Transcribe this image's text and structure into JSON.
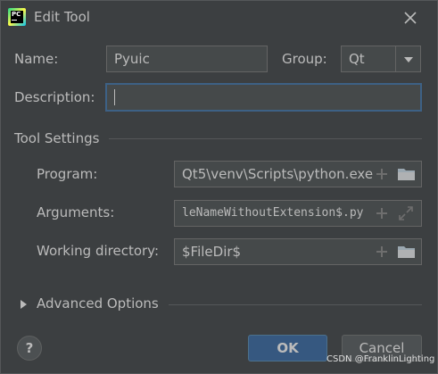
{
  "window": {
    "title": "Edit Tool"
  },
  "form": {
    "name_label": "Name:",
    "name_value": "Pyuic",
    "group_label": "Group:",
    "group_value": "Qt",
    "description_label": "Description:",
    "description_value": ""
  },
  "tool_settings": {
    "header": "Tool Settings",
    "program_label": "Program:",
    "program_value": "Qt5\\venv\\Scripts\\python.exe",
    "arguments_label": "Arguments:",
    "arguments_value": "leNameWithoutExtension$.py",
    "workdir_label": "Working directory:",
    "workdir_value": "$FileDir$"
  },
  "advanced": {
    "label": "Advanced Options"
  },
  "buttons": {
    "help": "?",
    "ok": "OK",
    "cancel": "Cancel"
  },
  "watermark": "CSDN @FranklinLighting"
}
